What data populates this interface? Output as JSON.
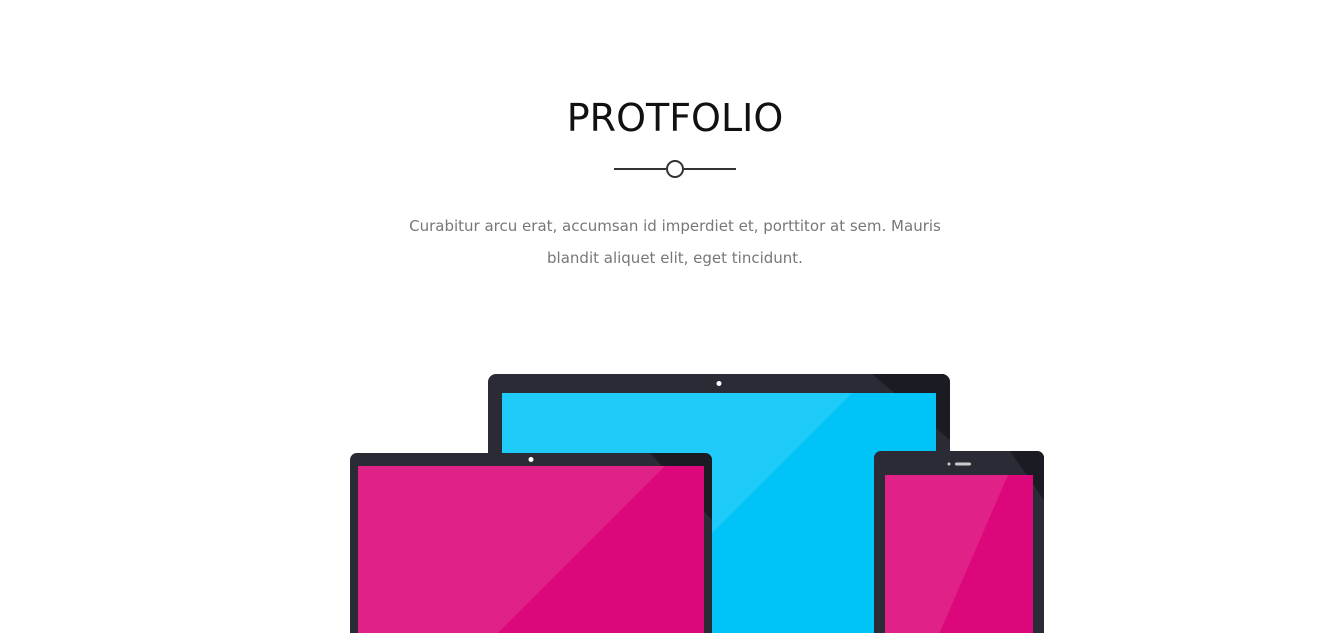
{
  "section": {
    "title": "PROTFOLIO",
    "description": "Curabitur arcu erat, accumsan id imperdiet et, porttitor at sem. Mauris blandit aliquet elit, eget tincidunt."
  },
  "colors": {
    "device_frame": "#2b2b36",
    "laptop_screen": "#00c4f7",
    "tablet_screen": "#dc087b",
    "phone_screen": "#dc087b",
    "divider": "#333333",
    "text_muted": "#777777"
  },
  "illustration": {
    "devices": [
      "laptop",
      "tablet",
      "phone"
    ]
  }
}
